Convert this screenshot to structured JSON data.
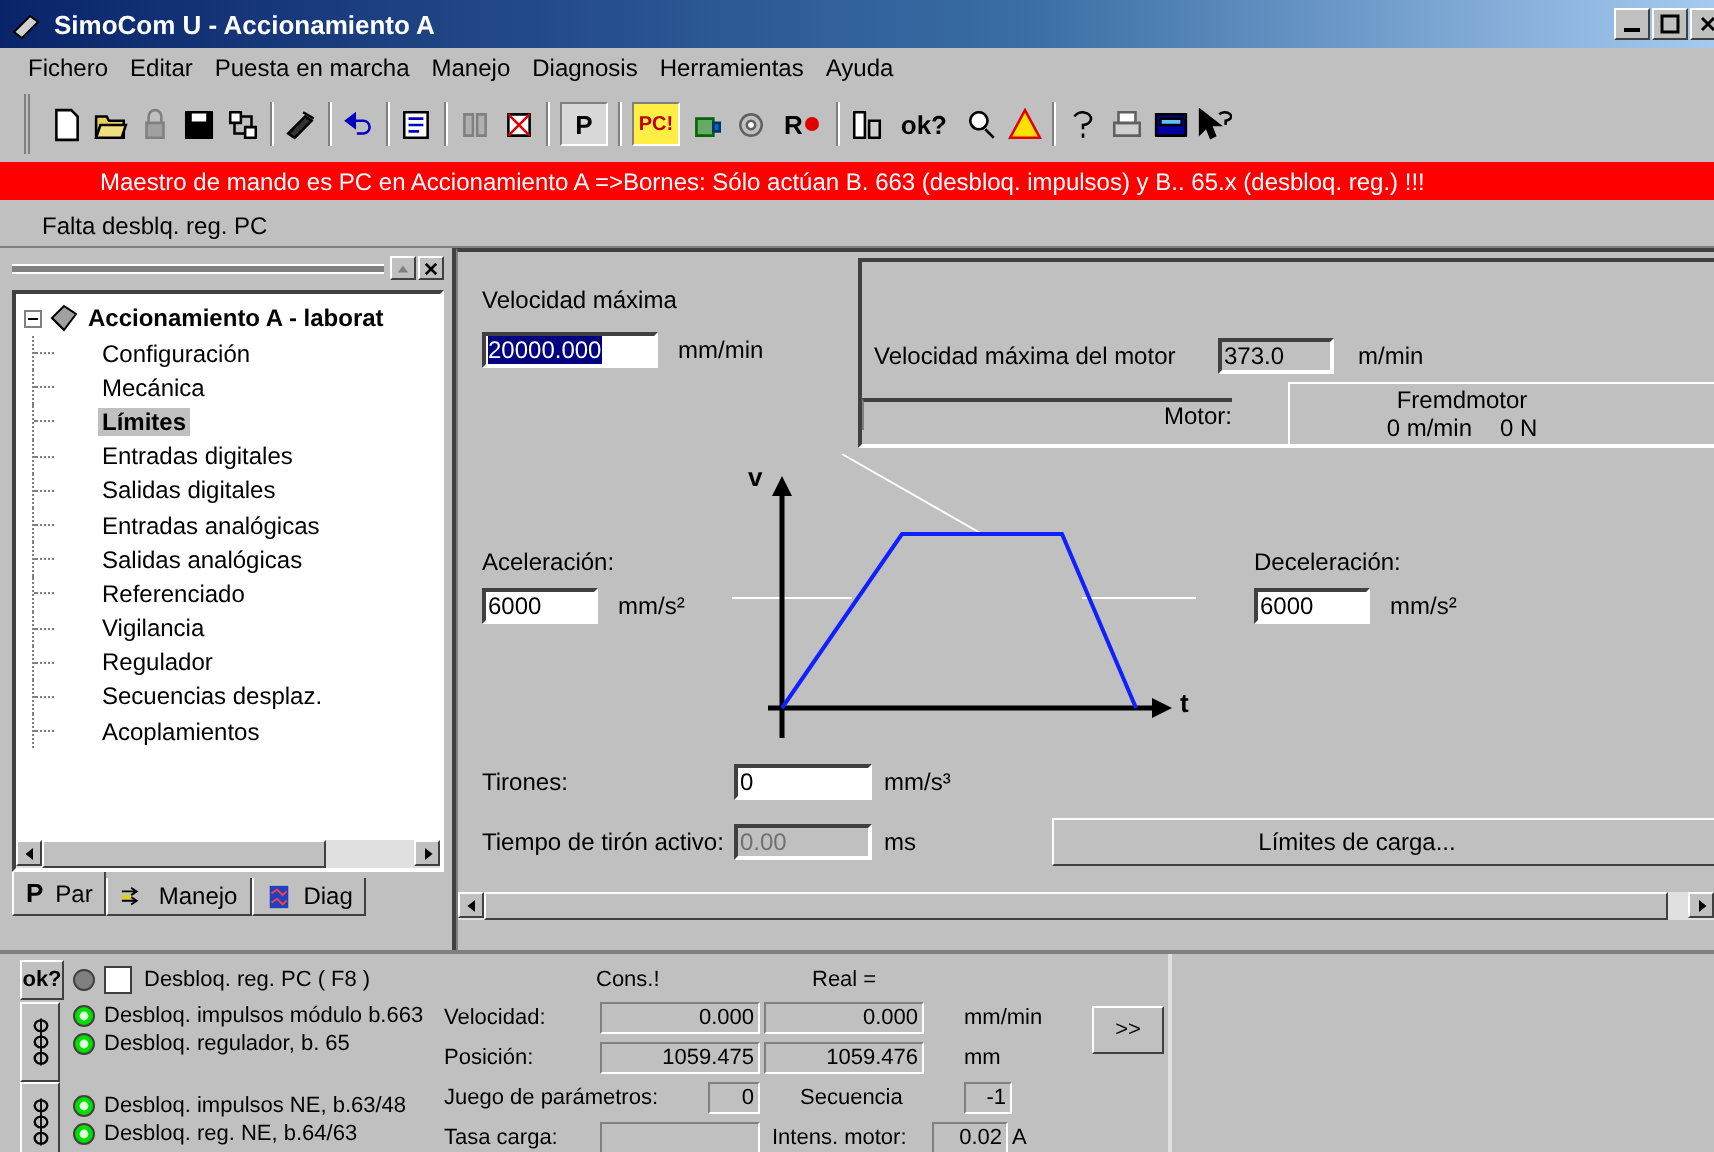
{
  "window": {
    "title": "SimoCom U - Accionamiento A"
  },
  "menu": [
    "Fichero",
    "Editar",
    "Puesta en marcha",
    "Manejo",
    "Diagnosis",
    "Herramientas",
    "Ayuda"
  ],
  "toolbar": [
    {
      "label": "P",
      "pressed": true
    },
    {
      "label": "PC!",
      "pressed": true
    },
    {
      "label": "R",
      "pressed": false
    },
    {
      "label": "ok?",
      "pressed": false
    }
  ],
  "alert": "Maestro de mando es PC en Accionamiento A =>Bornes:  Sólo actúan B. 663 (desbloq. impulsos) y B.. 65.x (desbloq. reg.) !!!",
  "status": "Falta desblq. reg. PC",
  "tree": {
    "label": "Accionamiento A - laborat",
    "expanded": true,
    "children": [
      {
        "label": "Configuración",
        "selected": false
      },
      {
        "label": "Mecánica",
        "selected": false
      },
      {
        "label": "Límites",
        "selected": true
      },
      {
        "label": "Entradas digitales",
        "selected": false
      },
      {
        "label": "Salidas digitales",
        "selected": false
      },
      {
        "label": "Entradas analógicas",
        "selected": false
      },
      {
        "label": "Salidas analógicas",
        "selected": false
      },
      {
        "label": "Referenciado",
        "selected": false
      },
      {
        "label": "Vigilancia",
        "selected": false
      },
      {
        "label": "Regulador",
        "selected": false
      },
      {
        "label": "Secuencias desplaz.",
        "selected": false
      },
      {
        "label": "Acoplamientos",
        "selected": false
      }
    ]
  },
  "tabs": [
    {
      "kind": "letter",
      "glyph": "P",
      "label": "Par",
      "selected": true
    },
    {
      "kind": "arrows",
      "label": "Manejo",
      "selected": false
    },
    {
      "kind": "scope",
      "label": "Diag",
      "selected": false
    }
  ],
  "form": {
    "max_speed": {
      "label": "Velocidad máxima",
      "value": "20000.000",
      "unit": "mm/min",
      "highlighted": true
    },
    "motor": {
      "speed_label": "Velocidad máxima del motor",
      "speed_value": "373.0",
      "speed_unit": "m/min",
      "motor_label": "Motor:",
      "motor_name": "Fremdmotor",
      "motor_speed": "0 m/min",
      "motor_force": "0 N"
    },
    "accel": {
      "label": "Aceleración:",
      "value": "6000",
      "unit": "mm/s²"
    },
    "decel": {
      "label": "Deceleración:",
      "value": "6000",
      "unit": "mm/s²"
    },
    "diagram": {
      "y_label": "v",
      "x_label": "t"
    },
    "jerk": {
      "label": "Tirones:",
      "value": "0",
      "unit": "mm/s³"
    },
    "jerk_time": {
      "label": "Tiempo de tirón activo:",
      "value": "0.00",
      "unit": "ms",
      "disabled": true
    },
    "load_limits_button": "Límites de carga..."
  },
  "bottom": {
    "ok_button": "ok?",
    "signal_groups": [
      [
        {
          "kind": "toggle",
          "label": "Desbloq. reg. PC  ( F8 )",
          "on": false,
          "checked": false
        }
      ],
      [
        {
          "kind": "led",
          "label": "Desbloq. impulsos módulo b.663",
          "on": true
        },
        {
          "kind": "led",
          "label": "Desbloq. regulador, b. 65",
          "on": true
        }
      ],
      [
        {
          "kind": "led",
          "label": "Desbloq. impulsos NE, b.63/48",
          "on": true
        },
        {
          "kind": "led",
          "label": "Desbloq. reg. NE, b.64/63",
          "on": true
        }
      ]
    ],
    "readouts": {
      "col_set": "Cons.!",
      "col_actual": "Real =",
      "rows": [
        {
          "label": "Velocidad:",
          "set": "0.000",
          "actual": "0.000",
          "unit": "mm/min"
        },
        {
          "label": "Posición:",
          "set": "1059.475",
          "actual": "1059.476",
          "unit": "mm"
        }
      ],
      "param_set": {
        "label": "Juego de parámetros:",
        "value": "0"
      },
      "sequence": {
        "label": "Secuencia",
        "value": "-1"
      },
      "load_rate": {
        "label": "Tasa carga:"
      },
      "motor_current": {
        "label": "Intens. motor:",
        "value": "0.02",
        "unit": "A"
      },
      "more_button": ">>"
    }
  }
}
